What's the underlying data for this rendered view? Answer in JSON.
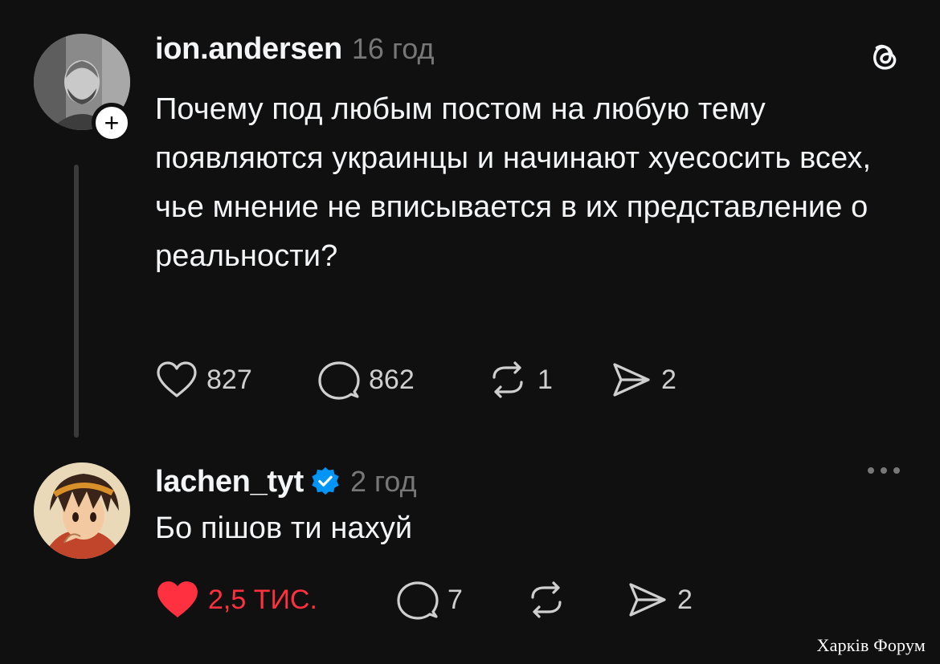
{
  "posts": [
    {
      "username": "ion.andersen",
      "time": "16 год",
      "text": "Почему под любым постом на любую тему появляются украинцы и начинают хуесосить всех, чье мнение не вписывается в их представление о реальности?",
      "likes": "827",
      "replies": "862",
      "reposts": "1",
      "shares": "2",
      "liked": false,
      "verified": false,
      "follow_badge": "+"
    },
    {
      "username": "lachen_tyt",
      "time": "2 год",
      "text": "Бо пішов ти нахуй",
      "likes": "2,5 ТИС.",
      "replies": "7",
      "reposts": "",
      "shares": "2",
      "liked": true,
      "verified": true
    }
  ],
  "watermark": "Харків Форум",
  "colors": {
    "background": "#101010",
    "text": "#f3f5f7",
    "muted": "#777777",
    "like_red": "#ff3040",
    "verified_blue": "#0095f6"
  },
  "icons": [
    "threads-logo-icon",
    "heart-icon",
    "comment-icon",
    "repost-icon",
    "share-icon",
    "verified-icon",
    "more-icon"
  ]
}
